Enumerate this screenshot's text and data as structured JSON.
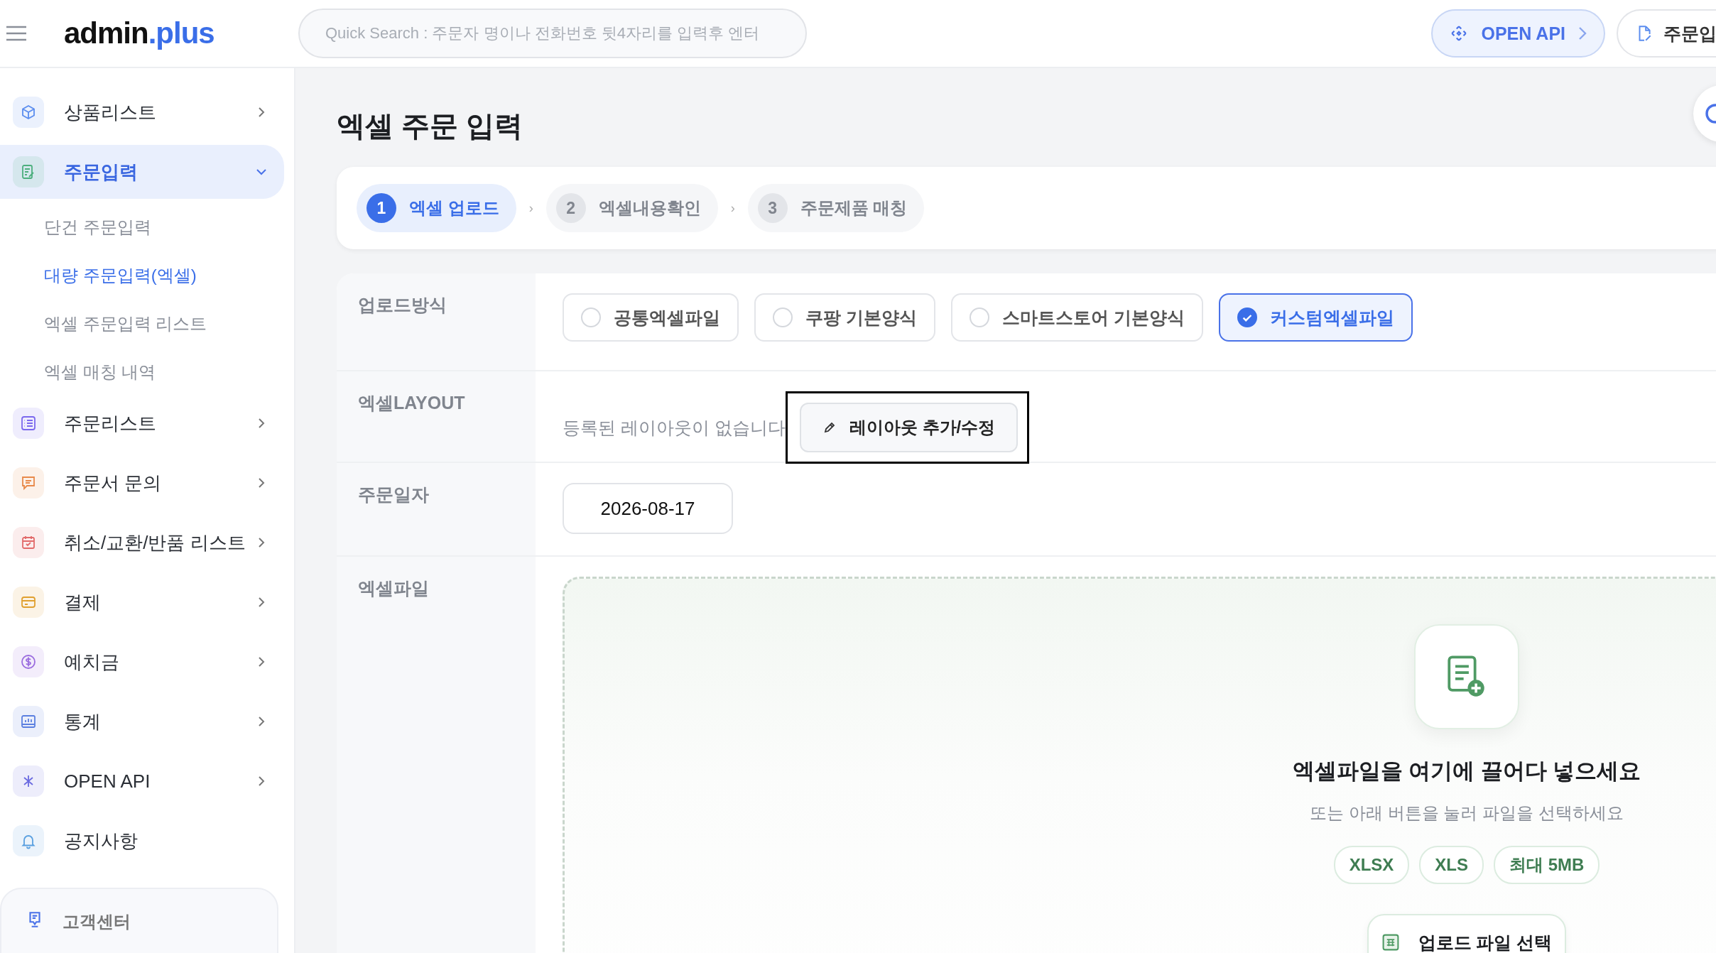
{
  "header": {
    "logo_main": "admin",
    "logo_accent": ".plus",
    "search": {
      "placeholder": "Quick Search : 주문자 명이나 전화번호 뒷4자리를 입력후 엔터"
    },
    "buttons": [
      {
        "label": "OPEN API",
        "kind": "api"
      },
      {
        "label": "주문입",
        "kind": "order"
      }
    ]
  },
  "sidebar": {
    "items": [
      {
        "label": "상품리스트",
        "kind": "group",
        "color": "#5b8def",
        "selected": false,
        "expanded": false
      },
      {
        "label": "주문입력",
        "kind": "group",
        "color": "#4caf7d",
        "selected": true,
        "expanded": true,
        "children": [
          {
            "label": "단건 주문입력",
            "selected": false
          },
          {
            "label": "대량 주문입력(엑셀)",
            "selected": true
          },
          {
            "label": "엑셀 주문입력 리스트",
            "selected": false
          },
          {
            "label": "엑셀 매칭 내역",
            "selected": false
          }
        ]
      },
      {
        "label": "주문리스트",
        "kind": "group",
        "color": "#7b68ee",
        "selected": false,
        "expanded": false
      },
      {
        "label": "주문서 문의",
        "kind": "group",
        "color": "#e8894a",
        "selected": false,
        "expanded": false
      },
      {
        "label": "취소/교환/반품 리스트",
        "kind": "group",
        "color": "#e26a6a",
        "selected": false,
        "expanded": false
      },
      {
        "label": "결제",
        "kind": "group",
        "color": "#e0a030",
        "selected": false,
        "expanded": false
      },
      {
        "label": "예치금",
        "kind": "group",
        "color": "#9b6ddf",
        "selected": false,
        "expanded": false
      },
      {
        "label": "통계",
        "kind": "group",
        "color": "#5b7fe0",
        "selected": false,
        "expanded": false
      },
      {
        "label": "OPEN API",
        "kind": "group",
        "color": "#6a6ae0",
        "selected": false,
        "expanded": false
      },
      {
        "label": "공지사항",
        "kind": "link",
        "color": "#5aa0e0",
        "selected": false
      }
    ],
    "support": {
      "label": "고객센터"
    }
  },
  "page": {
    "title": "엑셀 주문 입력",
    "steps": [
      {
        "number": "1",
        "label": "엑셀 업로드",
        "selected": true
      },
      {
        "number": "2",
        "label": "엑셀내용확인",
        "selected": false,
        "separator": "›"
      },
      {
        "number": "3",
        "label": "주문제품 매칭",
        "selected": false,
        "separator": "›"
      }
    ],
    "rows": [
      {
        "label": "업로드방식",
        "kind": "options",
        "options": [
          {
            "label": "공통엑셀파일",
            "selected": false
          },
          {
            "label": "쿠팡 기본양식",
            "selected": false
          },
          {
            "label": "스마트스토어 기본양식",
            "selected": false
          },
          {
            "label": "커스텀엑셀파일",
            "selected": true
          }
        ]
      },
      {
        "label": "엑셀LAYOUT",
        "kind": "layout",
        "text": "등록된 레이아웃이 없습니다",
        "button": {
          "label": "레이아웃 추가/수정",
          "highlighted": true
        }
      },
      {
        "label": "주문일자",
        "kind": "date",
        "value": "2026-08-17"
      },
      {
        "label": "엑셀파일",
        "kind": "dropzone",
        "title": "엑셀파일을 여기에 끌어다 넣으세요",
        "subtitle": "또는 아래 버튼을 눌러 파일을 선택하세요",
        "tags": [
          "XLSX",
          "XLS",
          "최대 5MB"
        ],
        "button": "업로드 파일 선택"
      }
    ]
  }
}
